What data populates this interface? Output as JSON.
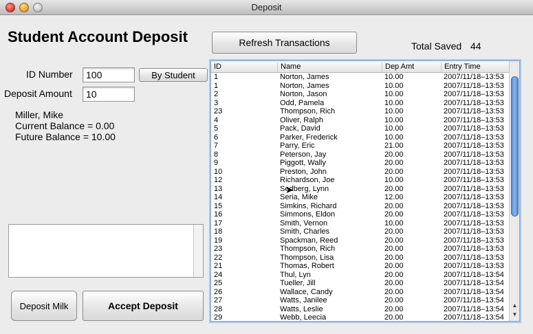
{
  "window": {
    "title": "Deposit"
  },
  "heading": "Student Account Deposit",
  "toolbar": {
    "refresh_label": "Refresh Transactions"
  },
  "totals": {
    "label": "Total Saved",
    "value": "44"
  },
  "form": {
    "id_label": "ID Number",
    "id_value": "100",
    "by_student_label": "By Student",
    "amount_label": "Deposit Amount",
    "amount_value": "10"
  },
  "student": {
    "name": "Miller, Mike",
    "current_balance": "Current Balance = 0.00",
    "future_balance": "Future Balance = 10.00"
  },
  "notes": {
    "value": ""
  },
  "buttons": {
    "deposit_milk": "Deposit Milk",
    "accept_deposit": "Accept Deposit"
  },
  "table": {
    "columns": [
      "ID",
      "Name",
      "Dep Amt",
      "Entry Time"
    ],
    "rows": [
      [
        "1",
        "Norton, James",
        "10.00",
        "2007/11/18–13:53"
      ],
      [
        "1",
        "Norton, James",
        "10.00",
        "2007/11/18–13:53"
      ],
      [
        "2",
        "Norton, Jason",
        "10.00",
        "2007/11/18–13:53"
      ],
      [
        "3",
        "Odd, Pamela",
        "10.00",
        "2007/11/18–13:53"
      ],
      [
        "23",
        "Thompson, Rich",
        "10.00",
        "2007/11/18–13:53"
      ],
      [
        "4",
        "Oliver, Ralph",
        "10.00",
        "2007/11/18–13:53"
      ],
      [
        "5",
        "Pack, David",
        "10.00",
        "2007/11/18–13:53"
      ],
      [
        "6",
        "Parker, Frederick",
        "10.00",
        "2007/11/18–13:53"
      ],
      [
        "7",
        "Parry, Eric",
        "21.00",
        "2007/11/18–13:53"
      ],
      [
        "8",
        "Peterson, Jay",
        "20.00",
        "2007/11/18–13:53"
      ],
      [
        "9",
        "Piggott, Wally",
        "20.00",
        "2007/11/18–13:53"
      ],
      [
        "10",
        "Preston, John",
        "20.00",
        "2007/11/18–13:53"
      ],
      [
        "12",
        "Richardson, Joe",
        "10.00",
        "2007/11/18–13:53"
      ],
      [
        "13",
        "Sedberg, Lynn",
        "20.00",
        "2007/11/18–13:53"
      ],
      [
        "14",
        "Seria, Mike",
        "12.00",
        "2007/11/18–13:53"
      ],
      [
        "15",
        "Simkins, Richard",
        "20.00",
        "2007/11/18–13:53"
      ],
      [
        "16",
        "Simmons, Eldon",
        "20.00",
        "2007/11/18–13:53"
      ],
      [
        "17",
        "Smith, Vernon",
        "10.00",
        "2007/11/18–13:53"
      ],
      [
        "18",
        "Smith, Charles",
        "20.00",
        "2007/11/18–13:53"
      ],
      [
        "19",
        "Spackman, Reed",
        "20.00",
        "2007/11/18–13:53"
      ],
      [
        "23",
        "Thompson, Rich",
        "20.00",
        "2007/11/18–13:53"
      ],
      [
        "22",
        "Thompson, Lisa",
        "20.00",
        "2007/11/18–13:53"
      ],
      [
        "21",
        "Thomas, Robert",
        "20.00",
        "2007/11/18–13:53"
      ],
      [
        "24",
        "Thul, Lyn",
        "20.00",
        "2007/11/18–13:54"
      ],
      [
        "25",
        "Tueller, Jill",
        "20.00",
        "2007/11/18–13:54"
      ],
      [
        "26",
        "Wallace, Candy",
        "20.00",
        "2007/11/18–13:54"
      ],
      [
        "27",
        "Watts, Janilee",
        "20.00",
        "2007/11/18–13:54"
      ],
      [
        "28",
        "Watts, Leslie",
        "20.00",
        "2007/11/18–13:54"
      ],
      [
        "29",
        "Webb, Leecia",
        "20.00",
        "2007/11/18–13:54"
      ]
    ]
  },
  "icons": {
    "close": "close-icon",
    "minimize": "minimize-icon",
    "zoom": "zoom-icon",
    "scroll_up": "scroll-up-icon",
    "scroll_down": "scroll-down-icon",
    "cursor": "mouse-cursor-icon"
  },
  "colors": {
    "selection_blue": "#7fa7d9",
    "scroll_thumb": "#5b8fd6"
  }
}
